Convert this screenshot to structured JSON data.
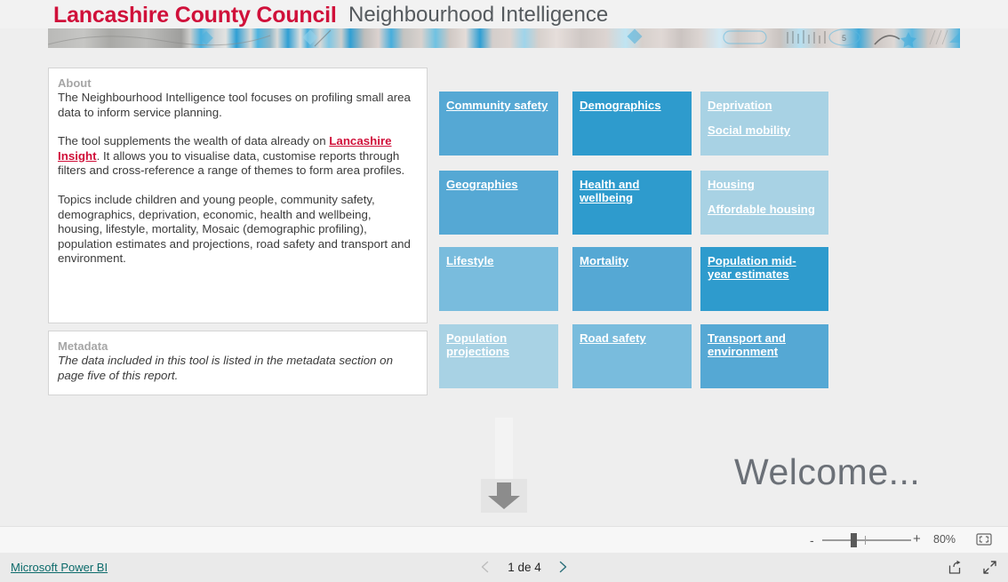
{
  "header": {
    "brand": "Lancashire County Council",
    "app_title": "Neighbourhood Intelligence",
    "brand_color": "#d0103a"
  },
  "about": {
    "label": "About",
    "paragraph1": "The Neighbourhood Intelligence tool focuses on profiling small area data to inform service planning.",
    "paragraph2_before": "The tool supplements the wealth of data already on ",
    "paragraph2_link": "Lancashire Insight",
    "paragraph2_after": ". It allows you to visualise data, customise reports through filters and cross-reference a range of themes to form area profiles.",
    "paragraph3": "Topics include children and young people, community safety, demographics, deprivation, economic, health and wellbeing, housing, lifestyle, mortality, Mosaic (demographic profiling), population estimates and projections, road safety and transport and environment."
  },
  "metadata": {
    "label": "Metadata",
    "text": "The data included in this tool is listed in the metadata section on page five of this report."
  },
  "tiles": [
    {
      "id": "community-safety",
      "links": [
        "Community safety"
      ],
      "color": "#55a8d4",
      "col": 0,
      "row": 0
    },
    {
      "id": "demographics",
      "links": [
        "Demographics"
      ],
      "color": "#2e9bcd",
      "col": 1,
      "row": 0
    },
    {
      "id": "deprivation",
      "links": [
        "Deprivation",
        "Social mobility"
      ],
      "color": "#a8d2e4",
      "col": 2,
      "row": 0
    },
    {
      "id": "geographies",
      "links": [
        "Geographies"
      ],
      "color": "#55a8d4",
      "col": 0,
      "row": 1
    },
    {
      "id": "health-and-wellbeing",
      "links": [
        "Health and wellbeing"
      ],
      "color": "#2e9bcd",
      "col": 1,
      "row": 1
    },
    {
      "id": "housing",
      "links": [
        "Housing",
        "Affordable housing"
      ],
      "color": "#a8d2e4",
      "col": 2,
      "row": 1
    },
    {
      "id": "lifestyle",
      "links": [
        "Lifestyle"
      ],
      "color": "#79bcdd",
      "col": 0,
      "row": 2
    },
    {
      "id": "mortality",
      "links": [
        "Mortality"
      ],
      "color": "#55a8d4",
      "col": 1,
      "row": 2
    },
    {
      "id": "population-mid-year-estimates",
      "links": [
        "Population mid-year estimates"
      ],
      "color": "#2e9bcd",
      "col": 2,
      "row": 2
    },
    {
      "id": "population-projections",
      "links": [
        "Population projections"
      ],
      "color": "#a8d2e4",
      "col": 0,
      "row": 3
    },
    {
      "id": "road-safety",
      "links": [
        "Road safety"
      ],
      "color": "#79bcdd",
      "col": 1,
      "row": 3
    },
    {
      "id": "transport-and-environment",
      "links": [
        "Transport and environment"
      ],
      "color": "#55a8d4",
      "col": 2,
      "row": 3
    }
  ],
  "canvas": {
    "welcome": "Welcome...",
    "arrow_icon": "arrow-down-icon"
  },
  "zoombar": {
    "minus_label": "-",
    "plus_label": "+",
    "zoom_level": "80%",
    "fit_icon": "fit-to-page-icon"
  },
  "bottombar": {
    "powerbi_label": "Microsoft Power BI",
    "page_label": "1 de 4",
    "prev_icon": "chevron-left-icon",
    "next_icon": "chevron-right-icon",
    "share_icon": "share-icon",
    "fullscreen_icon": "fullscreen-icon"
  }
}
